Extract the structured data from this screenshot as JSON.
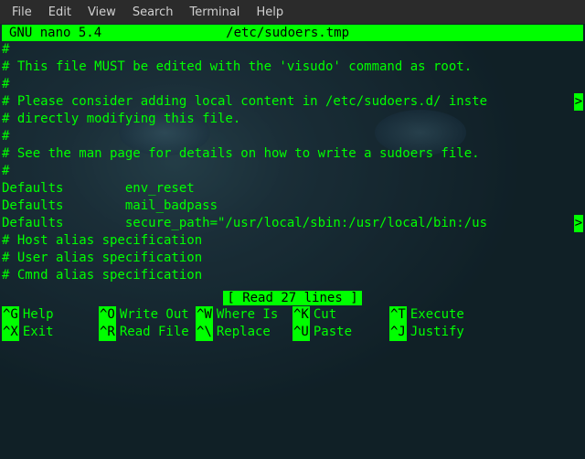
{
  "menubar": {
    "file": "File",
    "edit": "Edit",
    "view": "View",
    "search": "Search",
    "terminal": "Terminal",
    "help": "Help"
  },
  "titlebar": {
    "app": " GNU nano 5.4",
    "filename": "/etc/sudoers.tmp"
  },
  "editor_lines": {
    "l0": "#",
    "l1": "# This file MUST be edited with the 'visudo' command as root.",
    "l2": "#",
    "l3": "# Please consider adding local content in /etc/sudoers.d/ inste",
    "l4": "# directly modifying this file.",
    "l5": "#",
    "l6": "# See the man page for details on how to write a sudoers file.",
    "l7": "#",
    "l8": "Defaults        env_reset",
    "l9": "Defaults        mail_badpass",
    "l10": "Defaults        secure_path=\"/usr/local/sbin:/usr/local/bin:/us",
    "l11": "",
    "l12": "# Host alias specification",
    "l13": "",
    "l14": "# User alias specification",
    "l15": "",
    "l16": "# Cmnd alias specification"
  },
  "overflow": {
    "marker": ">"
  },
  "status": {
    "message": "[ Read 27 lines ]"
  },
  "shortcuts": {
    "help_key": "^G",
    "help_label": "Help",
    "writeout_key": "^O",
    "writeout_label": "Write Out",
    "whereis_key": "^W",
    "whereis_label": "Where Is",
    "cut_key": "^K",
    "cut_label": "Cut",
    "execute_key": "^T",
    "execute_label": "Execute",
    "exit_key": "^X",
    "exit_label": "Exit",
    "readfile_key": "^R",
    "readfile_label": "Read File",
    "replace_key": "^\\",
    "replace_label": "Replace",
    "paste_key": "^U",
    "paste_label": "Paste",
    "justify_key": "^J",
    "justify_label": "Justify"
  }
}
